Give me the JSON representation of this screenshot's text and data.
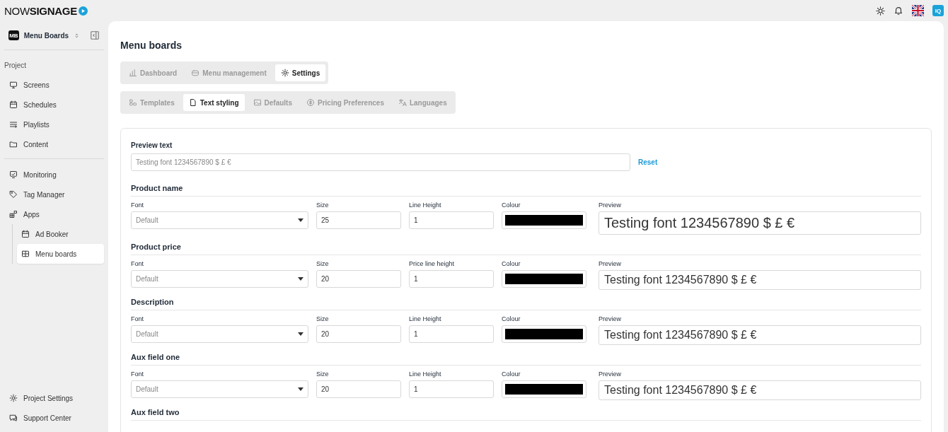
{
  "topbar": {
    "logo_light": "NOW",
    "logo_bold": "SIGNAGE",
    "avatar": "IQ"
  },
  "sidebar": {
    "workspace": {
      "badge": "MB",
      "name": "Menu Boards"
    },
    "section_label": "Project",
    "groups": [
      [
        {
          "label": "Screens",
          "selected": false
        },
        {
          "label": "Schedules",
          "selected": false
        },
        {
          "label": "Playlists",
          "selected": false
        },
        {
          "label": "Content",
          "selected": false
        }
      ],
      [
        {
          "label": "Monitoring",
          "selected": false
        },
        {
          "label": "Tag Manager",
          "selected": false
        },
        {
          "label": "Apps",
          "selected": false,
          "children": [
            {
              "label": "Ad Booker",
              "selected": false
            },
            {
              "label": "Menu boards",
              "selected": true
            }
          ]
        }
      ]
    ],
    "footer": [
      {
        "label": "Project Settings",
        "selected": false
      },
      {
        "label": "Support Center",
        "selected": false
      }
    ]
  },
  "page": {
    "title": "Menu boards",
    "tabs": [
      {
        "label": "Dashboard",
        "selected": false
      },
      {
        "label": "Menu management",
        "selected": false
      },
      {
        "label": "Settings",
        "selected": true
      }
    ],
    "subtabs": [
      {
        "label": "Templates",
        "selected": false
      },
      {
        "label": "Text styling",
        "selected": true
      },
      {
        "label": "Defaults",
        "selected": false
      },
      {
        "label": "Pricing Preferences",
        "selected": false
      },
      {
        "label": "Languages",
        "selected": false
      }
    ],
    "preview_text": {
      "label": "Preview text",
      "placeholder": "Testing font 1234567890 $ £ €",
      "reset": "Reset"
    },
    "sections": [
      {
        "title": "Product name",
        "font_label": "Font",
        "font": "Default",
        "size_label": "Size",
        "size": "25",
        "line_label": "Line Height",
        "line": "1",
        "colour_label": "Colour",
        "color": "#000000",
        "preview_label": "Preview",
        "preview": "Testing font 1234567890 $ £ €"
      },
      {
        "title": "Product price",
        "font_label": "Font",
        "font": "Default",
        "size_label": "Size",
        "size": "20",
        "line_label": "Price line height",
        "line": "1",
        "colour_label": "Colour",
        "color": "#000000",
        "preview_label": "Preview",
        "preview": "Testing font 1234567890 $ £ €"
      },
      {
        "title": "Description",
        "font_label": "Font",
        "font": "Default",
        "size_label": "Size",
        "size": "20",
        "line_label": "Line Height",
        "line": "1",
        "colour_label": "Colour",
        "color": "#000000",
        "preview_label": "Preview",
        "preview": "Testing font 1234567890 $ £ €"
      },
      {
        "title": "Aux field one",
        "font_label": "Font",
        "font": "Default",
        "size_label": "Size",
        "size": "20",
        "line_label": "Line Height",
        "line": "1",
        "colour_label": "Colour",
        "color": "#000000",
        "preview_label": "Preview",
        "preview": "Testing font 1234567890 $ £ €"
      },
      {
        "title": "Aux field two"
      }
    ]
  }
}
